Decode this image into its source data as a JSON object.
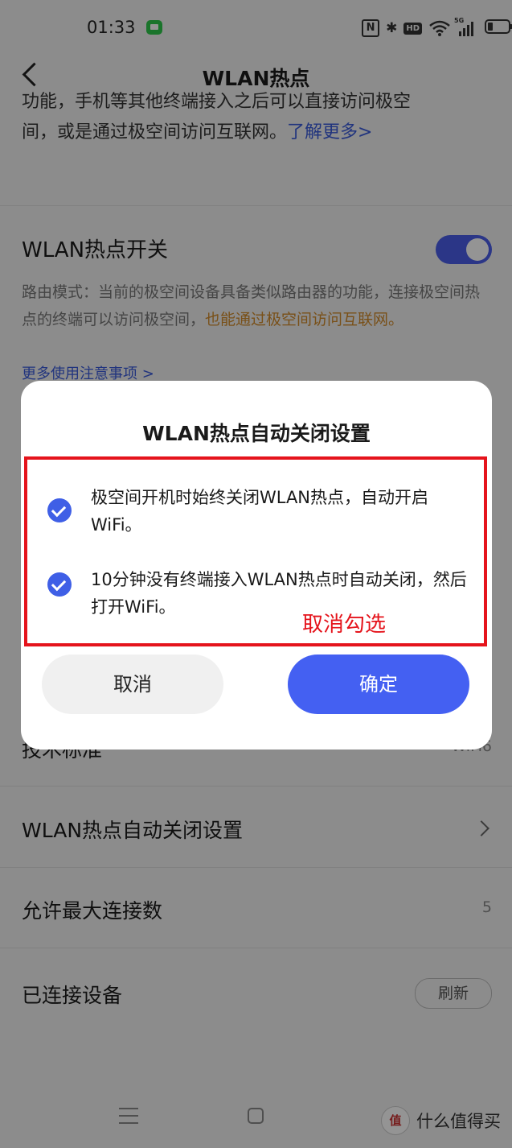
{
  "status_bar": {
    "time": "01:33",
    "network_label": "5G",
    "hd_label": "HD",
    "nfc_label": "N"
  },
  "header": {
    "title": "WLAN热点"
  },
  "intro": {
    "line1": "功能，手机等其他终端接入之后可以直接访问极空",
    "line2": "间，或是通过极空间访问互联网。",
    "learn_more": "了解更多>"
  },
  "hotspot_switch": {
    "label": "WLAN热点开关",
    "on": true,
    "description_prefix": "路由模式：当前的极空间设备具备类似路由器的功能，连接极空间热点的终端可以访问极空间，",
    "description_highlight": "也能通过极空间访问互联网。",
    "more_notes": "更多使用注意事项 >"
  },
  "settings_rows": [
    {
      "label": "技术标准",
      "value": "WiFi6"
    },
    {
      "label": "WLAN热点自动关闭设置",
      "value": ""
    },
    {
      "label": "允许最大连接数",
      "value": "5"
    },
    {
      "label": "已连接设备",
      "action": "刷新"
    }
  ],
  "dialog": {
    "title": "WLAN热点自动关闭设置",
    "options": [
      {
        "text": "极空间开机时始终关闭WLAN热点，自动开启WiFi。",
        "checked": true
      },
      {
        "text": "10分钟没有终端接入WLAN热点时自动关闭，然后打开WiFi。",
        "checked": true
      }
    ],
    "cancel_label": "取消",
    "ok_label": "确定"
  },
  "annotation": {
    "text": "取消勾选",
    "color": "#e5141c"
  },
  "watermark": {
    "logo": "值",
    "text": "什么值得买"
  },
  "colors": {
    "accent": "#4460f2",
    "highlight": "#d08a2a",
    "link": "#3a5bd9"
  }
}
